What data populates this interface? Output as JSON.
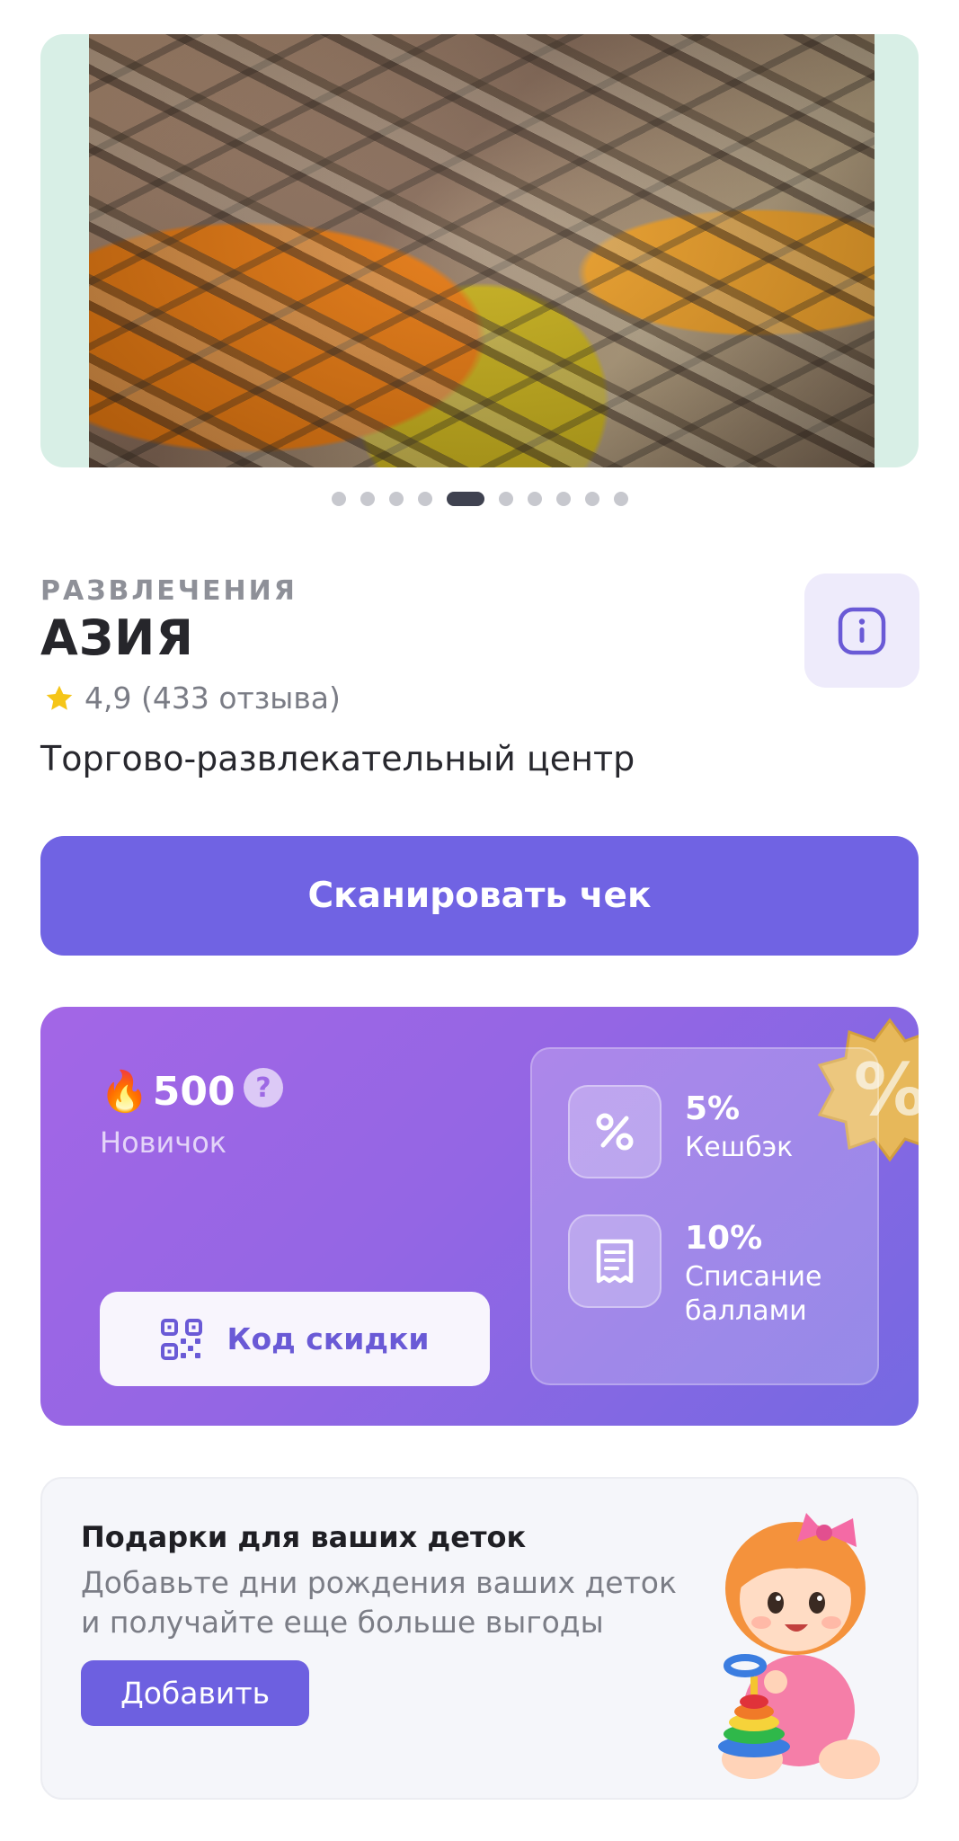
{
  "hero": {
    "slide_count": 10,
    "active_slide": 5
  },
  "venue": {
    "category": "РАЗВЛЕЧЕНИЯ",
    "name": "АЗИЯ",
    "rating_text": "4,9 (433 отзыва)",
    "description": "Торгово-развлекательный центр"
  },
  "actions": {
    "scan_label": "Сканировать чек"
  },
  "loyalty": {
    "points": "500",
    "points_icon": "🔥",
    "help_symbol": "?",
    "level": "Новичок",
    "discount_code_label": "Код скидки",
    "benefits": [
      {
        "icon": "percent-icon",
        "value": "5%",
        "label": "Кешбэк"
      },
      {
        "icon": "receipt-icon",
        "value": "10%",
        "label": "Списание баллами"
      }
    ]
  },
  "kids": {
    "title": "Подарки для ваших деток",
    "text": "Добавьте дни рождения ваших деток и получайте еще больше выгоды",
    "add_label": "Добавить"
  },
  "colors": {
    "accent": "#7063e3",
    "card_gradient_start": "#a366e6",
    "card_gradient_end": "#7569e2",
    "star": "#f5c518"
  }
}
